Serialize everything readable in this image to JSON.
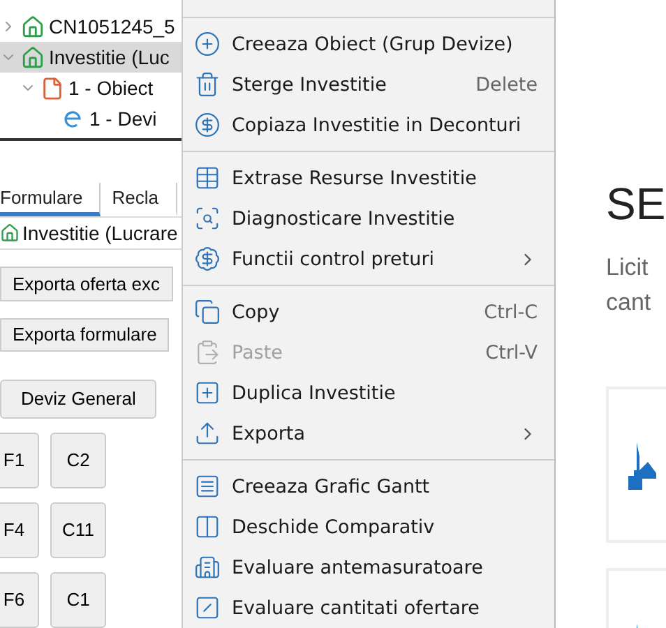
{
  "tree": [
    {
      "label": "CN1051245_5",
      "expanded": false,
      "selected": false,
      "kind": "investment"
    },
    {
      "label": "Investitie (Luc",
      "expanded": true,
      "selected": true,
      "kind": "investment",
      "children": [
        {
          "label": "1 - Obiect",
          "expanded": true,
          "selected": false,
          "kind": "object",
          "children": [
            {
              "label": "1 - Devi",
              "selected": false,
              "kind": "estimate"
            }
          ]
        }
      ]
    }
  ],
  "tabs": [
    {
      "label": "Formulare",
      "selected": true
    },
    {
      "label": "Recla",
      "selected": false
    }
  ],
  "context_row": {
    "label": "Investitie (Lucrare"
  },
  "export_buttons": [
    "Exporta oferta exc",
    "Exporta formulare"
  ],
  "deviz_button": "Deviz General",
  "form_buttons": [
    [
      "F1",
      "C2"
    ],
    [
      "F4",
      "C11"
    ],
    [
      "F6",
      "C1"
    ]
  ],
  "menu": [
    [
      {
        "label": "Creeaza Obiect (Grup Devize)",
        "submenu": false,
        "disabled": false
      },
      {
        "label": "Sterge Investitie",
        "shortcut": "Delete",
        "submenu": false,
        "disabled": false
      },
      {
        "label": "Copiaza Investitie in Deconturi",
        "submenu": false,
        "disabled": false
      }
    ],
    [
      {
        "label": "Extrase Resurse Investitie",
        "submenu": false,
        "disabled": false
      },
      {
        "label": "Diagnosticare Investitie",
        "submenu": false,
        "disabled": false
      },
      {
        "label": "Functii control preturi",
        "submenu": true,
        "disabled": false
      }
    ],
    [
      {
        "label": "Copy",
        "shortcut": "Ctrl-C",
        "submenu": false,
        "disabled": false
      },
      {
        "label": "Paste",
        "shortcut": "Ctrl-V",
        "submenu": false,
        "disabled": true
      },
      {
        "label": "Duplica Investitie",
        "submenu": false,
        "disabled": false
      },
      {
        "label": "Exporta",
        "submenu": true,
        "disabled": false
      }
    ],
    [
      {
        "label": "Creeaza Grafic Gantt",
        "submenu": false,
        "disabled": false
      },
      {
        "label": "Deschide Comparativ",
        "submenu": false,
        "disabled": false
      },
      {
        "label": "Evaluare antemasuratoare",
        "submenu": false,
        "disabled": false
      },
      {
        "label": "Evaluare cantitati ofertare",
        "submenu": false,
        "disabled": false
      }
    ]
  ],
  "page": {
    "heading": "SE",
    "text": [
      "Licit",
      "cant"
    ]
  }
}
